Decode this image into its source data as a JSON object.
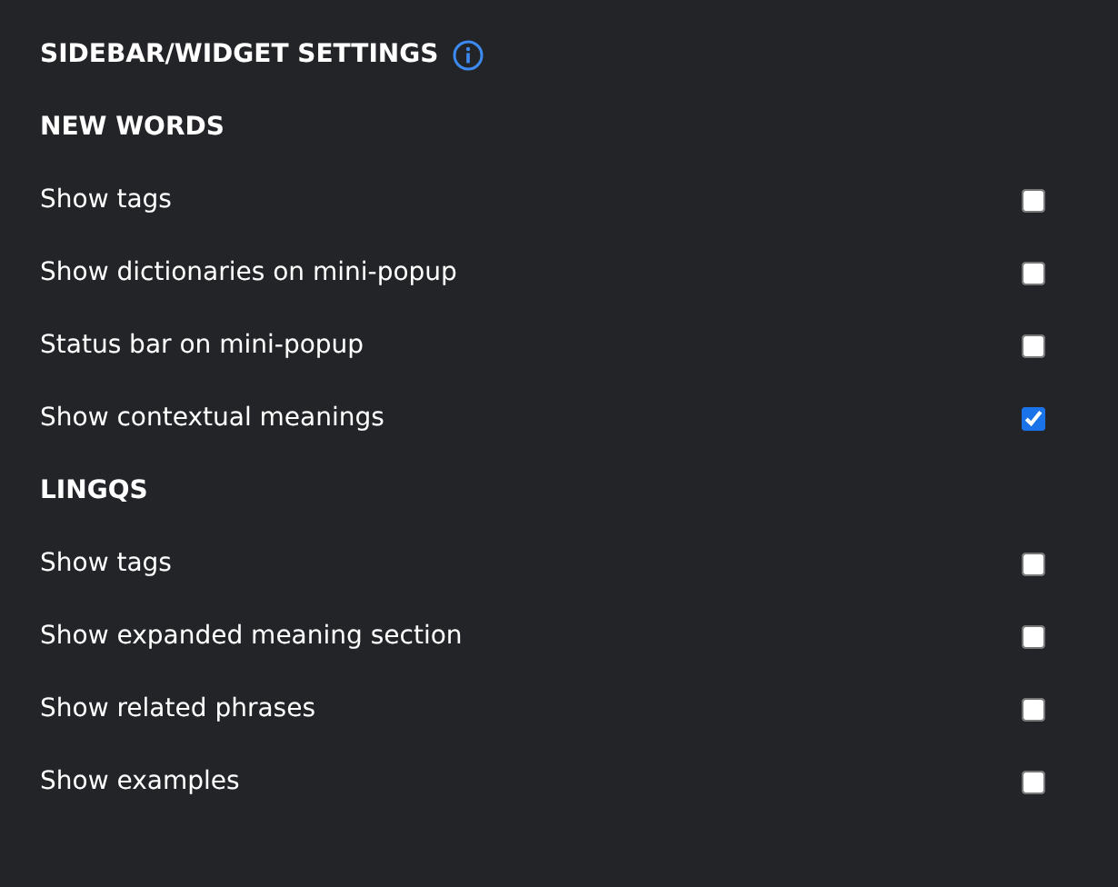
{
  "title": "SIDEBAR/WIDGET SETTINGS",
  "sections": [
    {
      "heading": "NEW WORDS",
      "options": [
        {
          "label": "Show tags",
          "checked": false
        },
        {
          "label": "Show dictionaries on mini-popup",
          "checked": false
        },
        {
          "label": "Status bar on mini-popup",
          "checked": false
        },
        {
          "label": "Show contextual meanings",
          "checked": true
        }
      ]
    },
    {
      "heading": "LINGQS",
      "options": [
        {
          "label": "Show tags",
          "checked": false
        },
        {
          "label": "Show expanded meaning section",
          "checked": false
        },
        {
          "label": "Show related phrases",
          "checked": false
        },
        {
          "label": "Show examples",
          "checked": false
        }
      ]
    }
  ]
}
